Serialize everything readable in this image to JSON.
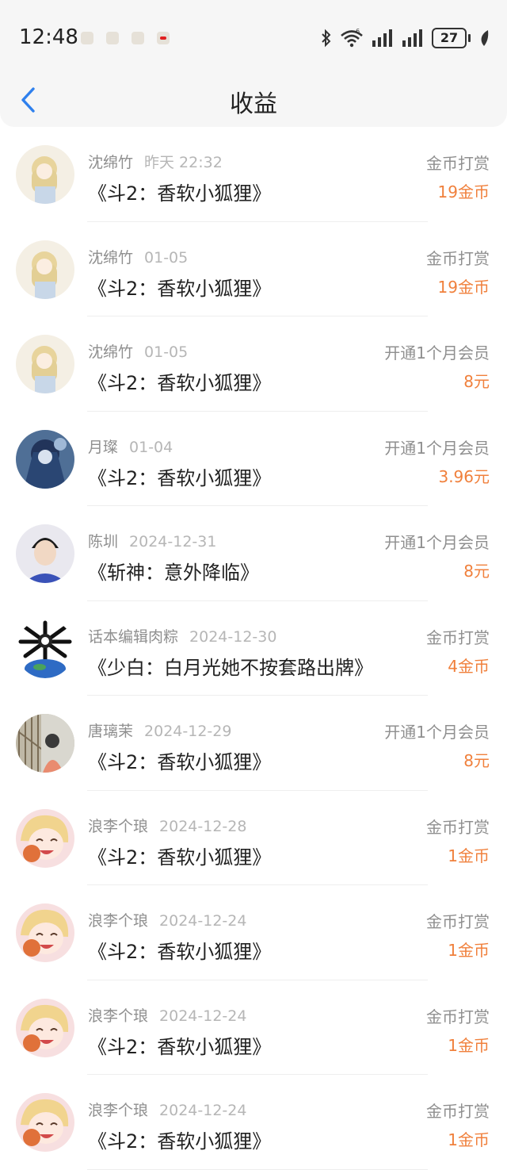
{
  "status_bar": {
    "time": "12:48",
    "battery": "27",
    "icons": [
      "bluetooth-icon",
      "wifi-icon",
      "signal-icon",
      "signal-icon",
      "battery-icon",
      "leaf-icon"
    ]
  },
  "header": {
    "title": "收益",
    "back_icon": "chevron-left-icon"
  },
  "colors": {
    "accent": "#2f80ed",
    "amount": "#f0803c",
    "muted": "#8f8f8f"
  },
  "rows": [
    {
      "name": "沈绵竹",
      "date": "昨天 22:32",
      "work": "《斗2：香软小狐狸》",
      "type": "金币打赏",
      "amount": "19金币",
      "avatar": "anime-girl-light"
    },
    {
      "name": "沈绵竹",
      "date": "01-05",
      "work": "《斗2：香软小狐狸》",
      "type": "金币打赏",
      "amount": "19金币",
      "avatar": "anime-girl-light"
    },
    {
      "name": "沈绵竹",
      "date": "01-05",
      "work": "《斗2：香软小狐狸》",
      "type": "开通1个月会员",
      "amount": "8元",
      "avatar": "anime-girl-light"
    },
    {
      "name": "月璨",
      "date": "01-04",
      "work": "《斗2：香软小狐狸》",
      "type": "开通1个月会员",
      "amount": "3.96元",
      "avatar": "blue-hair"
    },
    {
      "name": "陈圳",
      "date": "2024-12-31",
      "work": "《斩神：意外降临》",
      "type": "开通1个月会员",
      "amount": "8元",
      "avatar": "boy-photo"
    },
    {
      "name": "话本编辑肉粽",
      "date": "2024-12-30",
      "work": "《少白：白月光她不按套路出牌》",
      "type": "金币打赏",
      "amount": "4金币",
      "avatar": "earth-logo"
    },
    {
      "name": "唐璃茉",
      "date": "2024-12-29",
      "work": "《斗2：香软小狐狸》",
      "type": "开通1个月会员",
      "amount": "8元",
      "avatar": "girl-stairs"
    },
    {
      "name": "浪李个琅",
      "date": "2024-12-28",
      "work": "《斗2：香软小狐狸》",
      "type": "金币打赏",
      "amount": "1金币",
      "avatar": "pink-chibi"
    },
    {
      "name": "浪李个琅",
      "date": "2024-12-24",
      "work": "《斗2：香软小狐狸》",
      "type": "金币打赏",
      "amount": "1金币",
      "avatar": "pink-chibi"
    },
    {
      "name": "浪李个琅",
      "date": "2024-12-24",
      "work": "《斗2：香软小狐狸》",
      "type": "金币打赏",
      "amount": "1金币",
      "avatar": "pink-chibi"
    },
    {
      "name": "浪李个琅",
      "date": "2024-12-24",
      "work": "《斗2：香软小狐狸》",
      "type": "金币打赏",
      "amount": "1金币",
      "avatar": "pink-chibi"
    }
  ]
}
